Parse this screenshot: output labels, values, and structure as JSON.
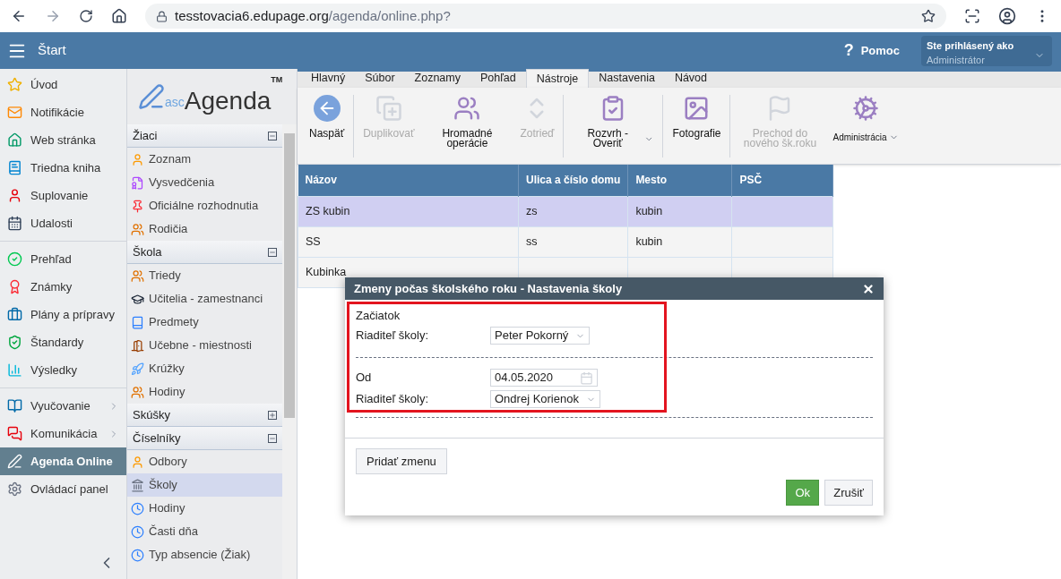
{
  "browser": {
    "url_host": "tesstovacia6.edupage.org",
    "url_path": "/agenda/online.php?"
  },
  "header": {
    "title": "Štart",
    "help_icon": "?",
    "help": "Pomoc",
    "user_label": "Ste prihlásený ako",
    "user_role": "Administrátor"
  },
  "nav_groups": [
    [
      {
        "label": "Úvod",
        "selected": false,
        "submenu": false
      },
      {
        "label": "Notifikácie",
        "selected": false,
        "submenu": false
      },
      {
        "label": "Web stránka",
        "selected": false,
        "submenu": false
      },
      {
        "label": "Triedna kniha",
        "selected": false,
        "submenu": false
      },
      {
        "label": "Suplovanie",
        "selected": false,
        "submenu": false
      },
      {
        "label": "Udalosti",
        "selected": false,
        "submenu": false
      }
    ],
    [
      {
        "label": "Prehľad",
        "selected": false,
        "submenu": false
      },
      {
        "label": "Známky",
        "selected": false,
        "submenu": false
      },
      {
        "label": "Plány a prípravy",
        "selected": false,
        "submenu": false
      },
      {
        "label": "Štandardy",
        "selected": false,
        "submenu": false
      },
      {
        "label": "Výsledky",
        "selected": false,
        "submenu": false
      }
    ],
    [
      {
        "label": "Vyučovanie",
        "selected": false,
        "submenu": true
      },
      {
        "label": "Komunikácia",
        "selected": false,
        "submenu": true
      },
      {
        "label": "Agenda Online",
        "selected": true,
        "submenu": false
      },
      {
        "label": "Ovládací panel",
        "selected": false,
        "submenu": false
      }
    ]
  ],
  "logo": {
    "prefix": "asc",
    "name": "Agenda",
    "mark": "TM"
  },
  "sections": [
    {
      "title": "Žiaci",
      "expanded": true,
      "items": [
        {
          "label": "Zoznam",
          "selected": false
        },
        {
          "label": "Vysvedčenia",
          "selected": false
        },
        {
          "label": "Oficiálne rozhodnutia",
          "selected": false
        },
        {
          "label": "Rodičia",
          "selected": false
        }
      ]
    },
    {
      "title": "Škola",
      "expanded": true,
      "items": [
        {
          "label": "Triedy",
          "selected": false
        },
        {
          "label": "Učitelia - zamestnanci",
          "selected": false
        },
        {
          "label": "Predmety",
          "selected": false
        },
        {
          "label": "Učebne - miestnosti",
          "selected": false
        },
        {
          "label": "Krúžky",
          "selected": false
        },
        {
          "label": "Hodiny",
          "selected": false
        }
      ]
    },
    {
      "title": "Skúšky",
      "expanded": false
    },
    {
      "title": "Číselníky",
      "expanded": true,
      "items": [
        {
          "label": "Odbory",
          "selected": false
        },
        {
          "label": "Školy",
          "selected": true
        },
        {
          "label": "Hodiny",
          "selected": false
        },
        {
          "label": "Časti dňa",
          "selected": false
        },
        {
          "label": "Typ absencie (Žiak)",
          "selected": false
        }
      ]
    }
  ],
  "tabs": [
    {
      "label": "Hlavný",
      "selected": false
    },
    {
      "label": "Súbor",
      "selected": false
    },
    {
      "label": "Zoznamy",
      "selected": false
    },
    {
      "label": "Pohľad",
      "selected": false
    },
    {
      "label": "Nástroje",
      "selected": true
    },
    {
      "label": "Nastavenia",
      "selected": false
    },
    {
      "label": "Návod",
      "selected": false
    }
  ],
  "toolbar": [
    {
      "label": "Naspäť",
      "disabled": false,
      "dropdown": false
    },
    {
      "label": "Duplikovať",
      "disabled": true,
      "dropdown": false
    },
    {
      "label": "Hromadné operácie",
      "disabled": false,
      "dropdown": false
    },
    {
      "label": "Zotrieď",
      "disabled": true,
      "dropdown": false
    },
    {
      "label": "Rozvrh - Overiť",
      "disabled": false,
      "dropdown": true
    },
    {
      "label": "Fotografie",
      "disabled": false,
      "dropdown": false
    },
    {
      "label": "Prechod do nového šk.roku",
      "disabled": true,
      "dropdown": false
    },
    {
      "label": "Administrácia",
      "disabled": false,
      "dropdown": true
    }
  ],
  "table": {
    "columns": [
      "Názov",
      "Ulica a číslo domu",
      "Mesto",
      "PSČ"
    ],
    "rows": [
      {
        "cells": [
          "ZS kubin",
          "zs",
          "kubin"
        ],
        "selected": true
      },
      {
        "cells": [
          "SS",
          "ss",
          "kubin"
        ],
        "selected": false
      },
      {
        "cells": [
          "Kubinka"
        ],
        "selected": false
      }
    ]
  },
  "dialog": {
    "title": "Zmeny počas školského roku - Nastavenia školy",
    "start_label": "Začiatok",
    "director_label_1": "Riaditeľ školy:",
    "director_1": "Peter Pokorný",
    "from_label": "Od",
    "from_date": "04.05.2020",
    "director_label_2": "Riaditeľ školy:",
    "director_2": "Ondrej Korienok",
    "add_button": "Pridať zmenu",
    "ok_button": "Ok",
    "cancel_button": "Zrušiť"
  }
}
